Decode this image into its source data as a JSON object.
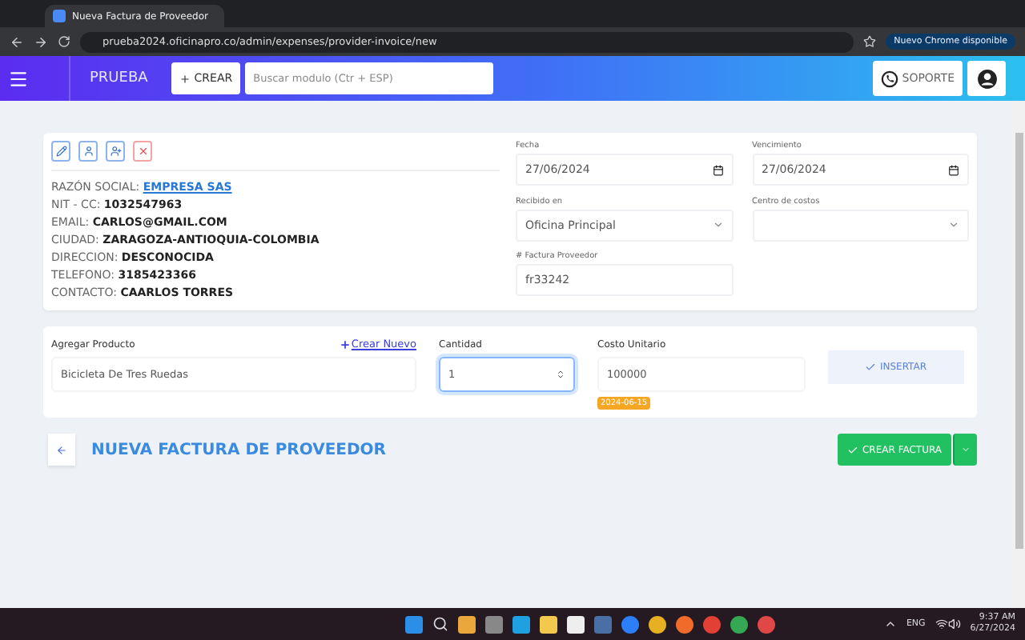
{
  "browser": {
    "tab_title": "Nueva Factura de Proveedor",
    "url": "prueba2024.oficinapro.co/admin/expenses/provider-invoice/new",
    "update_badge": "Nuevo Chrome disponible"
  },
  "app_header": {
    "brand": "PRUEBA",
    "create_button": "CREAR",
    "search": {
      "placeholder": "Buscar modulo (Ctr + ESP)"
    },
    "support_button": "SOPORTE"
  },
  "provider": {
    "actions": [
      {
        "kind": "edit"
      },
      {
        "kind": "user"
      },
      {
        "kind": "add-user"
      },
      {
        "kind": "remove"
      }
    ],
    "fields": [
      {
        "label": "RAZÓN SOCIAL:",
        "value": "EMPRESA SAS",
        "kind": "link"
      },
      {
        "label": "NIT - CC:",
        "value": "1032547963",
        "kind": "text"
      },
      {
        "label": "EMAIL:",
        "value": "CARLOS@GMAIL.COM",
        "kind": "text"
      },
      {
        "label": "CIUDAD:",
        "value": "ZARAGOZA-ANTIOQUIA-COLOMBIA",
        "kind": "text"
      },
      {
        "label": "DIRECCION:",
        "value": "DESCONOCIDA",
        "kind": "text"
      },
      {
        "label": "TELEFONO:",
        "value": "3185423366",
        "kind": "text"
      },
      {
        "label": "CONTACTO:",
        "value": "CAARLOS TORRES",
        "kind": "text"
      }
    ]
  },
  "invoice_form": [
    {
      "label": "Fecha",
      "value": "27/06/2024",
      "kind": "date"
    },
    {
      "label": "Vencimiento",
      "value": "27/06/2024",
      "kind": "date"
    },
    {
      "label": "Recibido en",
      "value": "Oficina Principal",
      "kind": "select"
    },
    {
      "label": "Centro de costos",
      "kind": "select"
    },
    {
      "label": "# Factura Proveedor",
      "value": "fr33242",
      "kind": "text"
    }
  ],
  "product_row": {
    "product_label": "Agregar Producto",
    "create_link": "Crear Nuevo",
    "product_value": "Bicicleta De Tres Ruedas",
    "quantity_label": "Cantidad",
    "quantity_value": "1",
    "cost_label": "Costo Unitario",
    "cost_value": "100000",
    "date_badge": "2024-06-15",
    "insert_button": "INSERTAR"
  },
  "page_header": {
    "title": "NUEVA FACTURA DE PROVEEDOR",
    "create_button": "CREAR FACTURA"
  },
  "taskbar": {
    "language": "ENG",
    "time": "9:37 AM",
    "date": "6/27/2024"
  }
}
